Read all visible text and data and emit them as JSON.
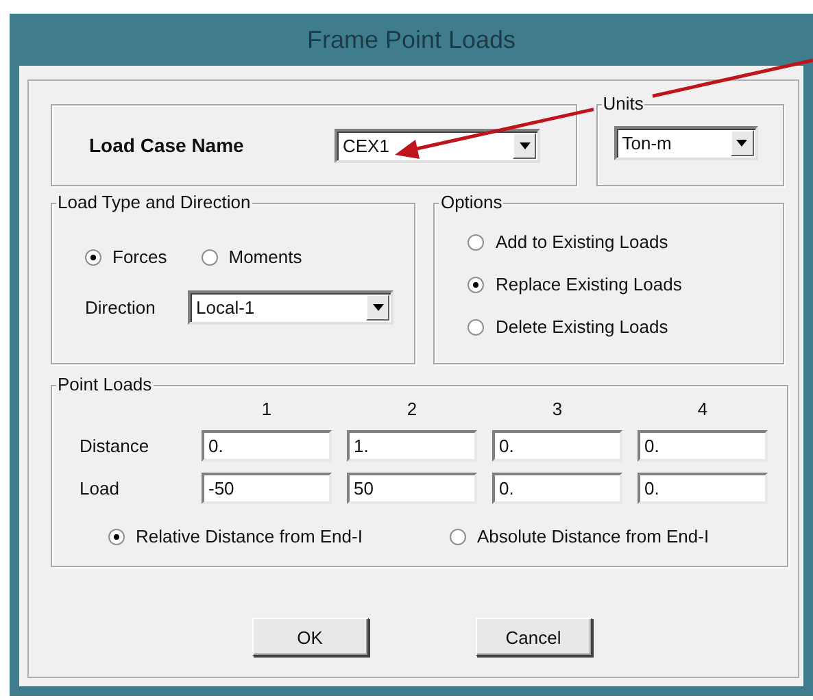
{
  "window": {
    "title": "Frame Point Loads"
  },
  "load_case": {
    "label": "Load Case Name",
    "value": "CEX1"
  },
  "units": {
    "legend": "Units",
    "value": "Ton-m"
  },
  "load_type": {
    "legend": "Load Type and Direction",
    "types": [
      {
        "label": "Forces",
        "selected": true
      },
      {
        "label": "Moments",
        "selected": false
      }
    ],
    "direction_label": "Direction",
    "direction": "Local-1"
  },
  "options": {
    "legend": "Options",
    "items": [
      {
        "label": "Add to Existing Loads",
        "selected": false
      },
      {
        "label": "Replace Existing Loads",
        "selected": true
      },
      {
        "label": "Delete Existing Loads",
        "selected": false
      }
    ]
  },
  "point_loads": {
    "legend": "Point Loads",
    "columns": [
      "1",
      "2",
      "3",
      "4"
    ],
    "rows": [
      {
        "label": "Distance",
        "values": [
          "0.",
          "1.",
          "0.",
          "0."
        ]
      },
      {
        "label": "Load",
        "values": [
          "-50",
          "50",
          "0.",
          "0."
        ]
      }
    ],
    "distance_modes": [
      {
        "label": "Relative Distance from End-I",
        "selected": true
      },
      {
        "label": "Absolute Distance from End-I",
        "selected": false
      }
    ]
  },
  "buttons": [
    "OK",
    "Cancel"
  ]
}
